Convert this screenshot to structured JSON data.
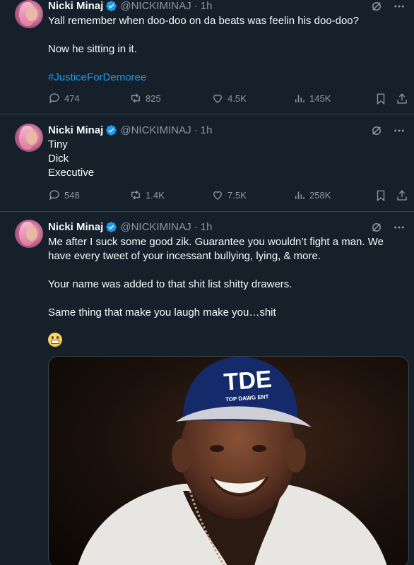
{
  "tweets": [
    {
      "name": "Nicki Minaj",
      "handle": "@NICKIMINAJ",
      "time": "· 1h",
      "lines": [
        "Yall remember when doo-doo on da beats was feelin his doo-doo?",
        "",
        "Now he sitting in it.",
        ""
      ],
      "hashtag": "#JusticeForDemoree",
      "replies": "474",
      "reposts": "825",
      "likes": "4.5K",
      "views": "145K"
    },
    {
      "name": "Nicki Minaj",
      "handle": "@NICKIMINAJ",
      "time": "· 1h",
      "lines": [
        "Tiny",
        "Dick",
        "Executive"
      ],
      "replies": "548",
      "reposts": "1.4K",
      "likes": "7.5K",
      "views": "258K"
    },
    {
      "name": "Nicki Minaj",
      "handle": "@NICKIMINAJ",
      "time": "· 1h",
      "lines": [
        "Me after I suck some good zik. Guarantee you wouldn’t fight a man. We",
        "have every tweet of your incessant bullying, lying, & more.",
        "",
        "Your name was added to that shit list shitty drawers.",
        "",
        "Same thing that make you laugh make you…shit"
      ],
      "emoji": "grimacing-face",
      "media": {
        "cap_text_main": "TDE",
        "cap_text_sub": "TOP DAWG ENT"
      }
    }
  ],
  "colors": {
    "background": "#15202b",
    "text": "#f7f9f9",
    "muted": "#8b98a5",
    "link": "#1d9bf0",
    "divider": "#38444d",
    "verified": "#1d9bf0"
  }
}
